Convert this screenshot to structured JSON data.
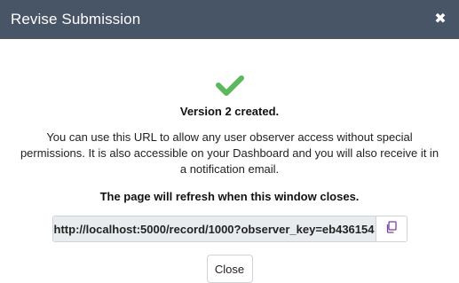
{
  "modal": {
    "title": "Revise Submission",
    "close_icon": "close-icon"
  },
  "body": {
    "success_icon": "checkmark-icon",
    "success_color": "#5cb85c",
    "heading": "Version 2 created.",
    "description": "You can use this URL to allow any user observer access without special permissions. It is also accessible on your Dashboard and you will also receive it in a notification email.",
    "refresh_notice": "The page will refresh when this window closes.",
    "url": "http://localhost:5000/record/1000?observer_key=eb436154",
    "copy_icon": "copy-icon",
    "close_button_label": "Close"
  },
  "colors": {
    "header_bg": "#475567",
    "accent_copy": "#7a3fa0"
  }
}
